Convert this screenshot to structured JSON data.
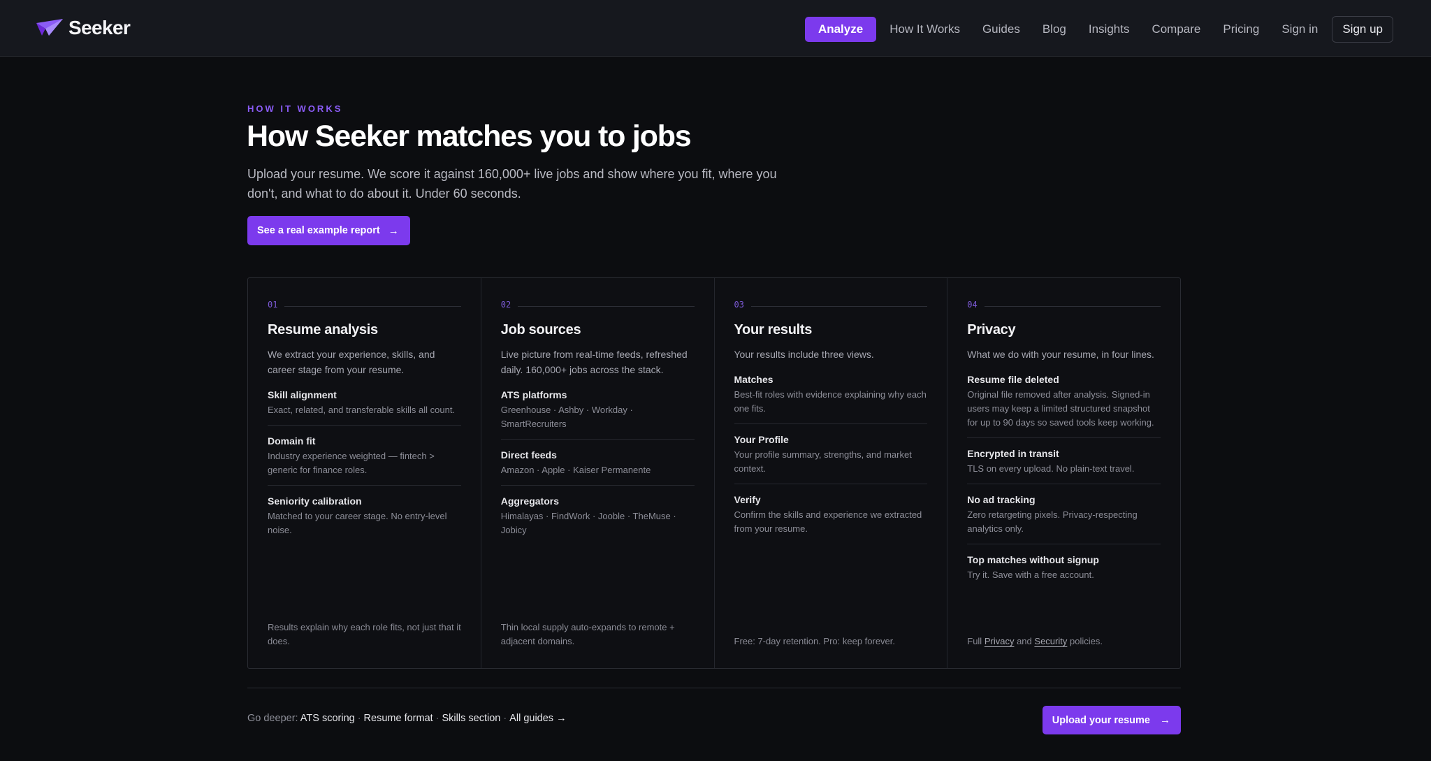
{
  "brand": {
    "name": "Seeker",
    "logo_icon": "paper-plane-icon",
    "accent": "#7c3aed"
  },
  "nav": {
    "analyze": "Analyze",
    "links": [
      "How It Works",
      "Guides",
      "Blog",
      "Insights",
      "Compare",
      "Pricing",
      "Sign in"
    ],
    "signup": "Sign up"
  },
  "hero": {
    "eyebrow": "HOW IT WORKS",
    "title": "How Seeker matches you to jobs",
    "subtitle": "Upload your resume. We score it against 160,000+ live jobs and show where you fit, where you don't, and what to do about it. Under 60 seconds.",
    "cta": "See a real example report",
    "cta_icon": "arrow-right-icon"
  },
  "steps": [
    {
      "num": "01",
      "title": "Resume analysis",
      "desc": "We extract your experience, skills, and career stage from your resume.",
      "items": [
        {
          "title": "Skill alignment",
          "desc": "Exact, related, and transferable skills all count."
        },
        {
          "title": "Domain fit",
          "desc": "Industry experience weighted — fintech > generic for finance roles."
        },
        {
          "title": "Seniority calibration",
          "desc": "Matched to your career stage. No entry-level noise."
        }
      ],
      "footer": "Results explain why each role fits, not just that it does."
    },
    {
      "num": "02",
      "title": "Job sources",
      "desc": "Live picture from real-time feeds, refreshed daily. 160,000+ jobs across the stack.",
      "items": [
        {
          "title": "ATS platforms",
          "desc": "Greenhouse · Ashby · Workday · SmartRecruiters"
        },
        {
          "title": "Direct feeds",
          "desc": "Amazon · Apple · Kaiser Permanente"
        },
        {
          "title": "Aggregators",
          "desc": "Himalayas · FindWork · Jooble · TheMuse · Jobicy"
        }
      ],
      "footer": "Thin local supply auto-expands to remote + adjacent domains."
    },
    {
      "num": "03",
      "title": "Your results",
      "desc": "Your results include three views.",
      "items": [
        {
          "title": "Matches",
          "desc": "Best-fit roles with evidence explaining why each one fits."
        },
        {
          "title": "Your Profile",
          "desc": "Your profile summary, strengths, and market context."
        },
        {
          "title": "Verify",
          "desc": "Confirm the skills and experience we extracted from your resume."
        }
      ],
      "footer": "Free: 7-day retention. Pro: keep forever."
    },
    {
      "num": "04",
      "title": "Privacy",
      "desc": "What we do with your resume, in four lines.",
      "items": [
        {
          "title": "Resume file deleted",
          "desc": "Original file removed after analysis. Signed-in users may keep a limited structured snapshot for up to 90 days so saved tools keep working."
        },
        {
          "title": "Encrypted in transit",
          "desc": "TLS on every upload. No plain-text travel."
        },
        {
          "title": "No ad tracking",
          "desc": "Zero retargeting pixels. Privacy-respecting analytics only."
        },
        {
          "title": "Top matches without signup",
          "desc": "Try it. Save with a free account."
        }
      ],
      "footer_parts": {
        "prefix": "Full",
        "privacy": "Privacy",
        "and": "and",
        "security": "Security",
        "suffix": "policies."
      }
    }
  ],
  "bottom": {
    "go_deeper": "Go deeper:",
    "links": [
      "ATS scoring",
      "Resume format",
      "Skills section",
      "All guides →"
    ],
    "separator": "·",
    "cta": "Upload your resume",
    "cta_icon": "arrow-right-icon"
  }
}
